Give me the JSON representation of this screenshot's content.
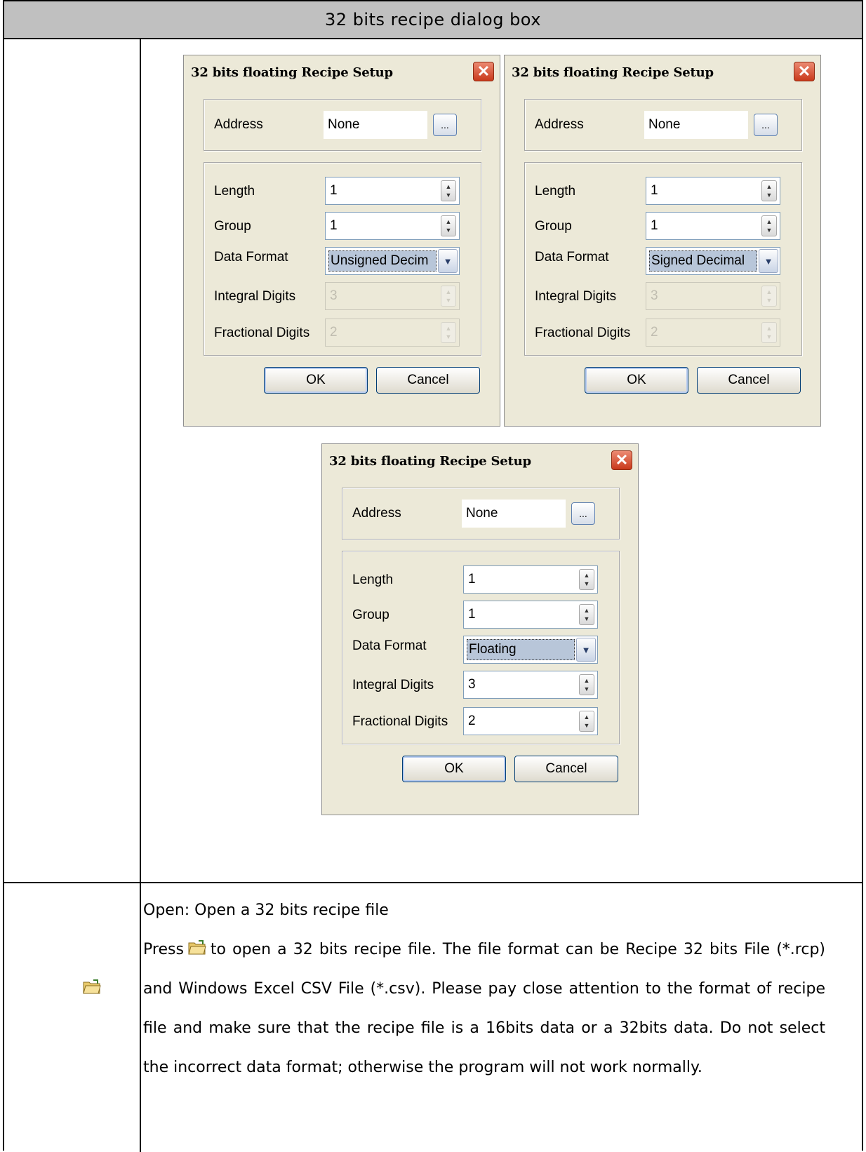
{
  "table": {
    "header": "32 bits recipe dialog box"
  },
  "dialogs": [
    {
      "title": "32 bits floating Recipe Setup",
      "close_glyph": "✕",
      "address_label": "Address",
      "address_value": "None",
      "browse_label": "...",
      "length_label": "Length",
      "length_value": "1",
      "group_label": "Group",
      "group_value": "1",
      "data_format_label": "Data Format",
      "data_format_value": "Unsigned Decim",
      "integral_label": "Integral Digits",
      "integral_value": "3",
      "integral_enabled": false,
      "fractional_label": "Fractional Digits",
      "fractional_value": "2",
      "fractional_enabled": false,
      "ok_label": "OK",
      "cancel_label": "Cancel"
    },
    {
      "title": "32 bits floating Recipe Setup",
      "close_glyph": "✕",
      "address_label": "Address",
      "address_value": "None",
      "browse_label": "...",
      "length_label": "Length",
      "length_value": "1",
      "group_label": "Group",
      "group_value": "1",
      "data_format_label": "Data Format",
      "data_format_value": "Signed Decimal",
      "integral_label": "Integral Digits",
      "integral_value": "3",
      "integral_enabled": false,
      "fractional_label": "Fractional Digits",
      "fractional_value": "2",
      "fractional_enabled": false,
      "ok_label": "OK",
      "cancel_label": "Cancel"
    },
    {
      "title": "32 bits floating Recipe Setup",
      "close_glyph": "✕",
      "address_label": "Address",
      "address_value": "None",
      "browse_label": "...",
      "length_label": "Length",
      "length_value": "1",
      "group_label": "Group",
      "group_value": "1",
      "data_format_label": "Data Format",
      "data_format_value": "Floating",
      "integral_label": "Integral Digits",
      "integral_value": "3",
      "integral_enabled": true,
      "fractional_label": "Fractional Digits",
      "fractional_value": "2",
      "fractional_enabled": true,
      "ok_label": "OK",
      "cancel_label": "Cancel"
    }
  ],
  "open_section": {
    "icon": "open-folder-icon",
    "heading": "Open: Open a 32 bits recipe file",
    "press_text": "Press",
    "body_text": "to open a 32 bits recipe file. The file format can be Recipe 32 bits File (*.rcp) and Windows Excel CSV File (*.csv). Please pay close attention to the format of recipe file and make sure that the recipe file is a 16bits data or a 32bits data. Do not select the incorrect data format; otherwise the program will not work normally."
  }
}
